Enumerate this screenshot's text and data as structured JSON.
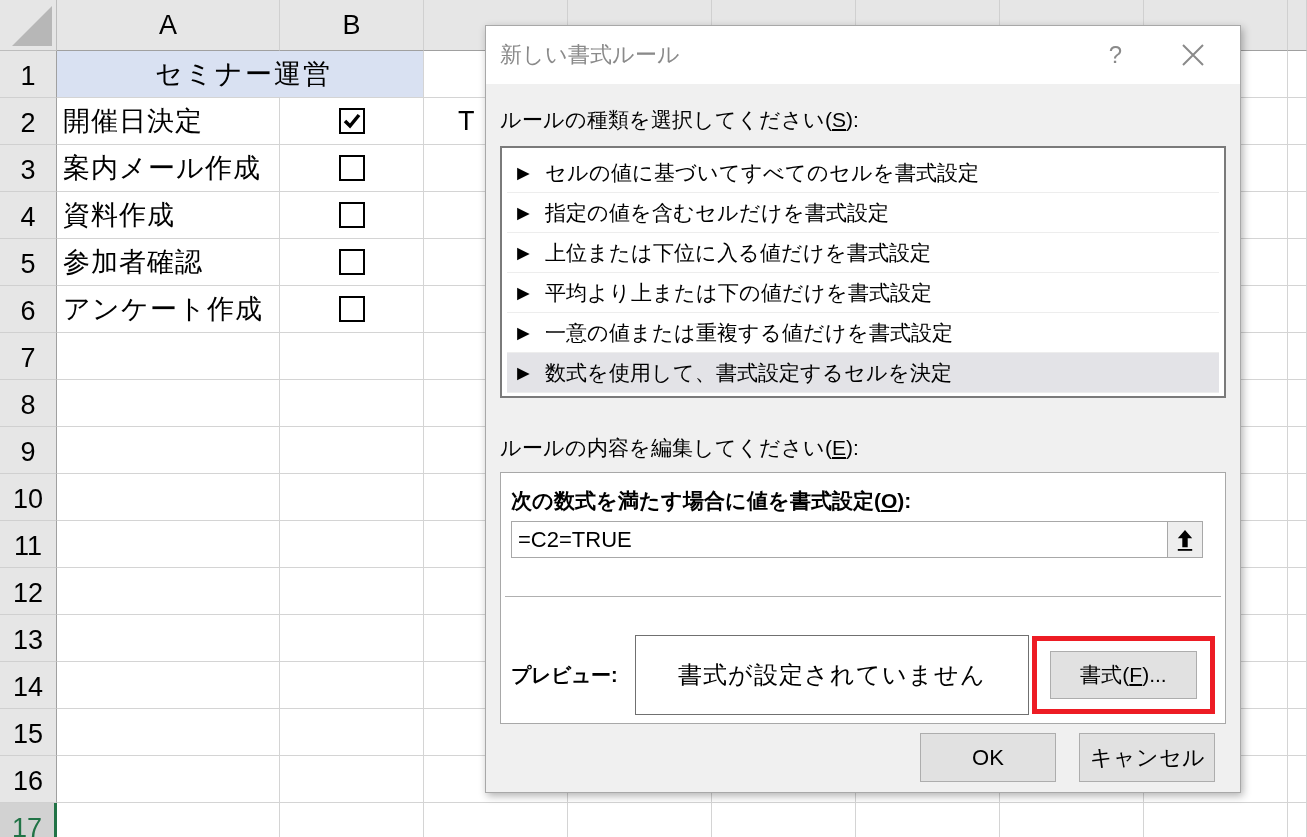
{
  "sheet": {
    "columns": [
      "A",
      "B"
    ],
    "rows": [
      {
        "number": "1",
        "selected": false
      },
      {
        "number": "2",
        "selected": false
      },
      {
        "number": "3",
        "selected": false
      },
      {
        "number": "4",
        "selected": false
      },
      {
        "number": "5",
        "selected": false
      },
      {
        "number": "6",
        "selected": false
      },
      {
        "number": "7",
        "selected": false
      },
      {
        "number": "8",
        "selected": false
      },
      {
        "number": "9",
        "selected": false
      },
      {
        "number": "10",
        "selected": false
      },
      {
        "number": "11",
        "selected": false
      },
      {
        "number": "12",
        "selected": false
      },
      {
        "number": "13",
        "selected": false
      },
      {
        "number": "14",
        "selected": false
      },
      {
        "number": "15",
        "selected": false
      },
      {
        "number": "16",
        "selected": false
      },
      {
        "number": "17",
        "selected": true
      }
    ],
    "title": "セミナー運営",
    "tasks": [
      {
        "name": "開催日決定",
        "checked": true
      },
      {
        "name": "案内メール作成",
        "checked": false
      },
      {
        "name": "資料作成",
        "checked": false
      },
      {
        "name": "参加者確認",
        "checked": false
      },
      {
        "name": "アンケート作成",
        "checked": false
      }
    ],
    "c2_value": "T"
  },
  "dialog": {
    "title": "新しい書式ルール",
    "help": "?",
    "rule_type_label": {
      "prefix": "ルールの種類を選択してください(",
      "key": "S",
      "suffix": "):"
    },
    "rule_types": [
      {
        "label": "セルの値に基づいてすべてのセルを書式設定",
        "selected": false
      },
      {
        "label": "指定の値を含むセルだけを書式設定",
        "selected": false
      },
      {
        "label": "上位または下位に入る値だけを書式設定",
        "selected": false
      },
      {
        "label": "平均より上または下の値だけを書式設定",
        "selected": false
      },
      {
        "label": "一意の値または重複する値だけを書式設定",
        "selected": false
      },
      {
        "label": "数式を使用して、書式設定するセルを決定",
        "selected": true
      }
    ],
    "bullet": "►",
    "edit_label": {
      "prefix": "ルールの内容を編集してください(",
      "key": "E",
      "suffix": "):"
    },
    "formula_label": {
      "prefix": "次の数式を満たす場合に値を書式設定(",
      "key": "O",
      "suffix": "):"
    },
    "formula": "=C2=TRUE",
    "preview_label": "プレビュー:",
    "preview_text": "書式が設定されていません",
    "format_button": {
      "prefix": "書式(",
      "key": "F",
      "suffix": ")...",
      "highlighted": true
    },
    "ok": "OK",
    "cancel": "キャンセル"
  }
}
